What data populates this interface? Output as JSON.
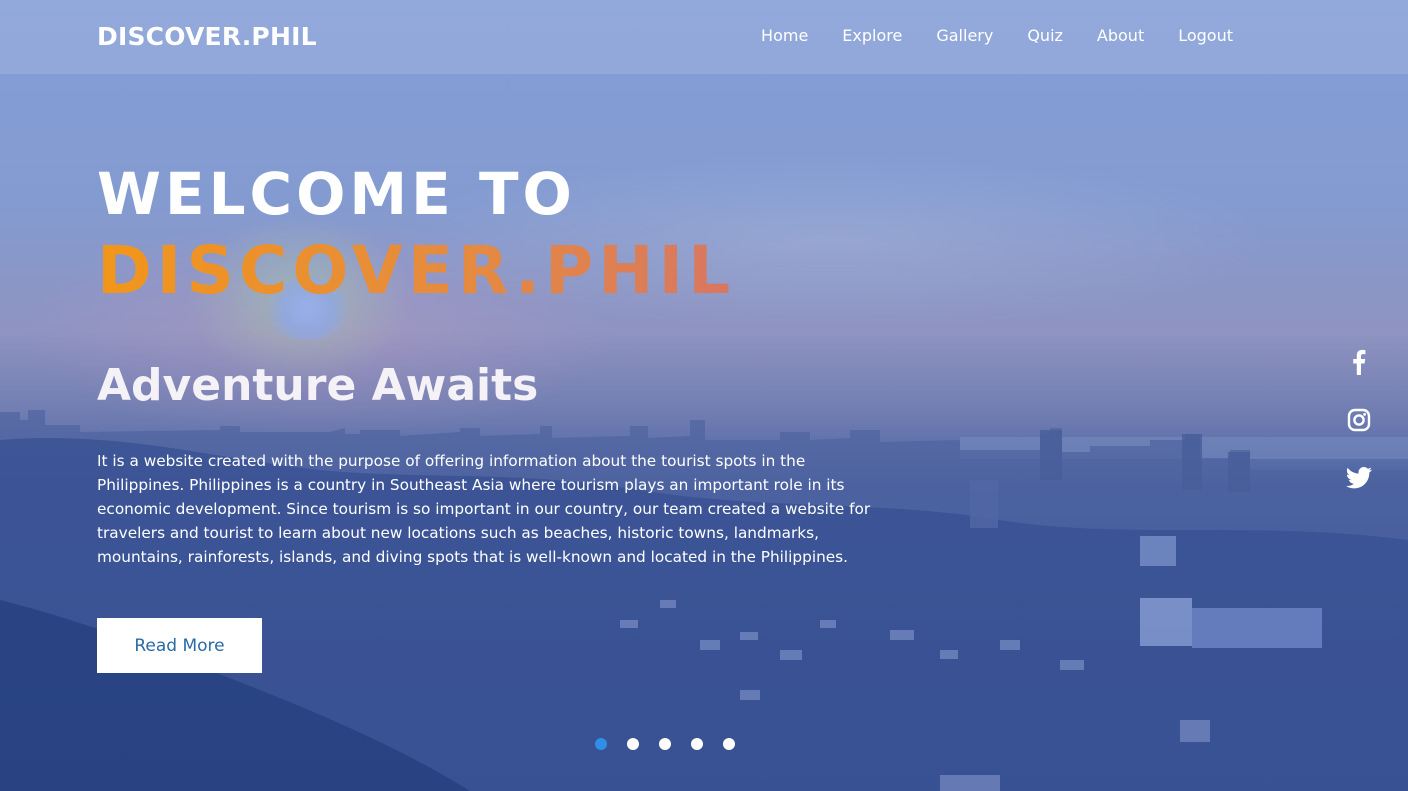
{
  "nav": {
    "logo": "DISCOVER.PHIL",
    "links": [
      "Home",
      "Explore",
      "Gallery",
      "Quiz",
      "About",
      "Logout"
    ]
  },
  "hero": {
    "welcome": "WELCOME TO",
    "brand": "DISCOVER.PHIL",
    "tagline": "Adventure Awaits",
    "description": "It is a website created with the purpose of offering information about the tourist spots in the Philippines. Philippines is a country in Southeast Asia where tourism plays an important role in its economic development. Since tourism is so important in our country, our team created a website for travelers and tourist to learn about new locations such as beaches, historic towns, landmarks, mountains, rainforests, islands, and diving spots that is well-known and located in the Philippines.",
    "button_label": "Read More"
  },
  "social": [
    "facebook-icon",
    "instagram-icon",
    "twitter-icon"
  ],
  "slider": {
    "dot_count": 5,
    "active_index": 0,
    "active_color": "#2f8fe6"
  },
  "colors": {
    "brand_gradient_start": "#f2961a",
    "brand_gradient_end": "#d87661",
    "button_text": "#2a6aa6"
  }
}
